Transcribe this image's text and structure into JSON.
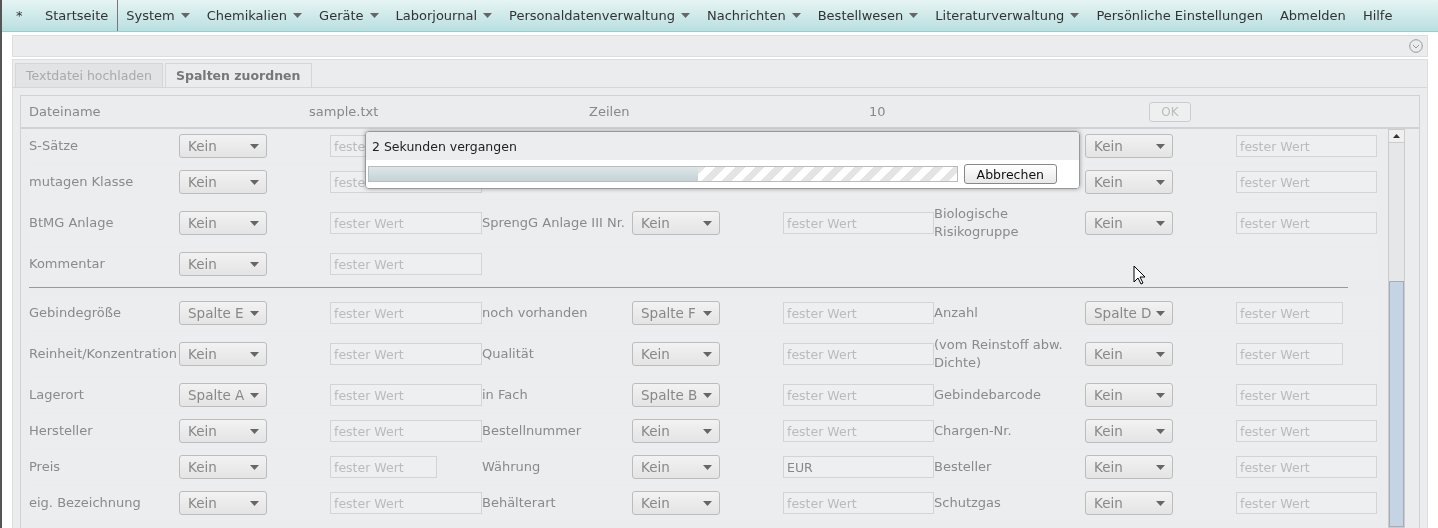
{
  "menu": [
    {
      "label": "*",
      "has_menu": false
    },
    {
      "label": "Startseite",
      "has_menu": false,
      "separator_after": true
    },
    {
      "label": "System",
      "has_menu": true
    },
    {
      "label": "Chemikalien",
      "has_menu": true
    },
    {
      "label": "Geräte",
      "has_menu": true
    },
    {
      "label": "Laborjournal",
      "has_menu": true
    },
    {
      "label": "Personaldatenverwaltung",
      "has_menu": true
    },
    {
      "label": "Nachrichten",
      "has_menu": true
    },
    {
      "label": "Bestellwesen",
      "has_menu": true
    },
    {
      "label": "Literaturverwaltung",
      "has_menu": true
    },
    {
      "label": "Persönliche Einstellungen",
      "has_menu": false
    },
    {
      "label": "Abmelden",
      "has_menu": false
    },
    {
      "label": "Hilfe",
      "has_menu": false
    }
  ],
  "tabs": [
    {
      "label": "Textdatei hochladen",
      "selected": false
    },
    {
      "label": "Spalten zuordnen",
      "selected": true
    }
  ],
  "file_info": {
    "filename_label": "Dateiname",
    "filename": "sample.txt",
    "rows_label": "Zeilen",
    "rows": "10",
    "ok_button": {
      "label": "OK",
      "disabled": true
    }
  },
  "sections": [
    {
      "rows": [
        {
          "tall": false,
          "left": {
            "label": "S-Sätze",
            "select": "Kein",
            "input": {
              "placeholder": "feste",
              "short": false
            }
          },
          "right": {
            "select": "Kein",
            "input": {
              "placeholder": "fester Wert",
              "short": false
            }
          }
        },
        {
          "tall": false,
          "left": {
            "label": "mutagen Klasse",
            "select": "Kein",
            "input": {
              "placeholder": "feste",
              "short": false
            }
          },
          "right": {
            "select": "Kein",
            "input": {
              "placeholder": "fester Wert",
              "short": false
            }
          }
        },
        {
          "tall": true,
          "left": {
            "label": "BtMG Anlage",
            "select": "Kein",
            "input": {
              "placeholder": "fester Wert",
              "short": false
            }
          },
          "middle": {
            "label": "SprengG Anlage III Nr.",
            "select": "Kein",
            "input": {
              "placeholder": "fester Wert",
              "short": false
            }
          },
          "right": {
            "label": "Biologische Risikogruppe",
            "select": "Kein",
            "input": {
              "placeholder": "fester Wert",
              "short": false
            }
          }
        },
        {
          "tall": false,
          "left": {
            "label": "Kommentar",
            "select": "Kein",
            "input": {
              "placeholder": "fester Wert",
              "short": false
            }
          }
        }
      ]
    },
    {
      "rows": [
        {
          "tall": false,
          "left": {
            "label": "Gebindegröße",
            "select": "Spalte E",
            "input": {
              "placeholder": "fester Wert",
              "short": false
            }
          },
          "middle": {
            "label": "noch vorhanden",
            "select": "Spalte F",
            "input": {
              "placeholder": "fester Wert",
              "short": false
            }
          },
          "right": {
            "label": "Anzahl",
            "select": "Spalte D",
            "input": {
              "placeholder": "fester Wert",
              "short": true
            }
          }
        },
        {
          "tall": true,
          "left": {
            "label": "Reinheit/Konzentration",
            "select": "Kein",
            "input": {
              "placeholder": "fester Wert",
              "short": false
            }
          },
          "middle": {
            "label": "Qualität",
            "select": "Kein",
            "input": {
              "placeholder": "fester Wert",
              "short": false
            }
          },
          "right": {
            "label": "(vom Reinstoff abw. Dichte)",
            "select": "Kein",
            "input": {
              "placeholder": "fester Wert",
              "short": true
            }
          }
        },
        {
          "tall": false,
          "left": {
            "label": "Lagerort",
            "select": "Spalte A",
            "input": {
              "placeholder": "fester Wert",
              "short": false
            }
          },
          "middle": {
            "label": "in Fach",
            "select": "Spalte B",
            "input": {
              "placeholder": "fester Wert",
              "short": false
            }
          },
          "right": {
            "label": "Gebindebarcode",
            "select": "Kein",
            "input": {
              "placeholder": "fester Wert",
              "short": false
            }
          }
        },
        {
          "tall": false,
          "left": {
            "label": "Hersteller",
            "select": "Kein",
            "input": {
              "placeholder": "fester Wert",
              "short": false
            }
          },
          "middle": {
            "label": "Bestellnummer",
            "select": "Kein",
            "input": {
              "placeholder": "fester Wert",
              "short": false
            }
          },
          "right": {
            "label": "Chargen-Nr.",
            "select": "Kein",
            "input": {
              "placeholder": "fester Wert",
              "short": false
            }
          }
        },
        {
          "tall": false,
          "left": {
            "label": "Preis",
            "select": "Kein",
            "input": {
              "placeholder": "fester Wert",
              "short": true
            }
          },
          "middle": {
            "label": "Währung",
            "select": "Kein",
            "input": {
              "value": "EUR",
              "short": false
            }
          },
          "right": {
            "label": "Besteller",
            "select": "Kein",
            "input": {
              "placeholder": "fester Wert",
              "short": false
            }
          }
        },
        {
          "tall": false,
          "left": {
            "label": "eig. Bezeichnung",
            "select": "Kein",
            "input": {
              "placeholder": "fester Wert",
              "short": false
            }
          },
          "middle": {
            "label": "Behälterart",
            "select": "Kein",
            "input": {
              "placeholder": "fester Wert",
              "short": false
            }
          },
          "right": {
            "label": "Schutzgas",
            "select": "Kein",
            "input": {
              "placeholder": "fester Wert",
              "short": false
            }
          }
        }
      ]
    }
  ],
  "progress_dialog": {
    "message": "2 Sekunden vergangen",
    "level": 0.56,
    "cancel_button": "Abbrechen"
  }
}
